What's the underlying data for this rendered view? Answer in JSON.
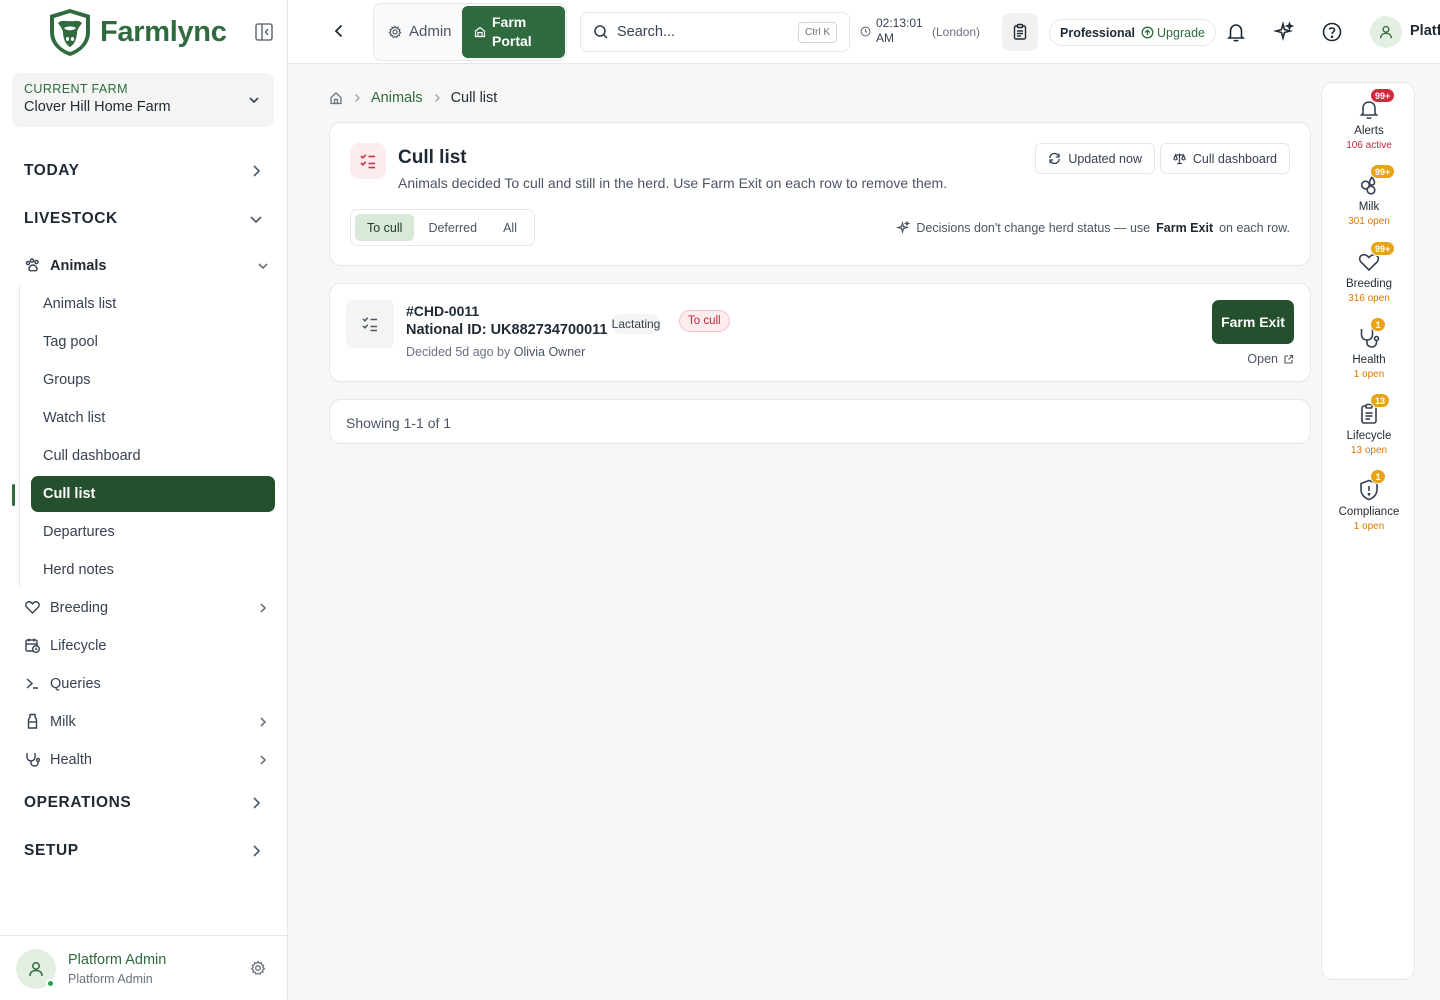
{
  "brand": {
    "name": "Farmlync"
  },
  "farm": {
    "label": "CURRENT FARM",
    "name": "Clover Hill Home Farm"
  },
  "nav": {
    "sections": {
      "today": "TODAY",
      "livestock": "LIVESTOCK",
      "operations": "OPERATIONS",
      "setup": "SETUP"
    },
    "animals": "Animals",
    "animal_sub": [
      "Animals list",
      "Tag pool",
      "Groups",
      "Watch list",
      "Cull dashboard",
      "Cull list",
      "Departures",
      "Herd notes"
    ],
    "breeding": "Breeding",
    "lifecycle": "Lifecycle",
    "queries": "Queries",
    "milk": "Milk",
    "health": "Health"
  },
  "user": {
    "name": "Platform Admin",
    "role": "Platform Admin",
    "top_name": "Platf"
  },
  "topbar": {
    "admin": "Admin",
    "portal": "Farm Portal",
    "search_placeholder": "Search...",
    "shortcut": "Ctrl K",
    "time": "02:13:01 AM",
    "timezone": "(London)",
    "plan": "Professional",
    "upgrade": "Upgrade"
  },
  "breadcrumb": {
    "parent": "Animals",
    "current": "Cull list"
  },
  "header": {
    "title": "Cull list",
    "description": "Animals decided To cull and still in the herd. Use Farm Exit on each row to remove them.",
    "updated": "Updated now",
    "dashboard": "Cull dashboard",
    "filters": [
      "To cull",
      "Deferred",
      "All"
    ],
    "hint_pre": "Decisions don't change herd status — use",
    "hint_bold": "Farm Exit",
    "hint_post": "on each row."
  },
  "rows": [
    {
      "id": "#CHD-0011",
      "national_id": "National ID: UK882734700011",
      "decided": "Decided 5d ago by",
      "decided_by": "Olivia Owner",
      "status": "Lactating",
      "decision": "To cull",
      "action": "Farm Exit",
      "open": "Open"
    }
  ],
  "pager": {
    "text": "Showing 1-1 of 1"
  },
  "rail": [
    {
      "label": "Alerts",
      "sub": "106 active",
      "badge": "99+",
      "badge_color": "#d1293d"
    },
    {
      "label": "Milk",
      "sub": "301 open",
      "badge": "99+",
      "badge_color": "#e8a317"
    },
    {
      "label": "Breeding",
      "sub": "316 open",
      "badge": "99+",
      "badge_color": "#e8a317"
    },
    {
      "label": "Health",
      "sub": "1 open",
      "badge": "1",
      "badge_color": "#e8a317"
    },
    {
      "label": "Lifecycle",
      "sub": "13 open",
      "badge": "13",
      "badge_color": "#e8a317"
    },
    {
      "label": "Compliance",
      "sub": "1 open",
      "badge": "1",
      "badge_color": "#e8a317"
    }
  ],
  "colors": {
    "brand": "#2f6b3e",
    "brand_dark": "#24502d",
    "cull_red": "#c0293e"
  }
}
